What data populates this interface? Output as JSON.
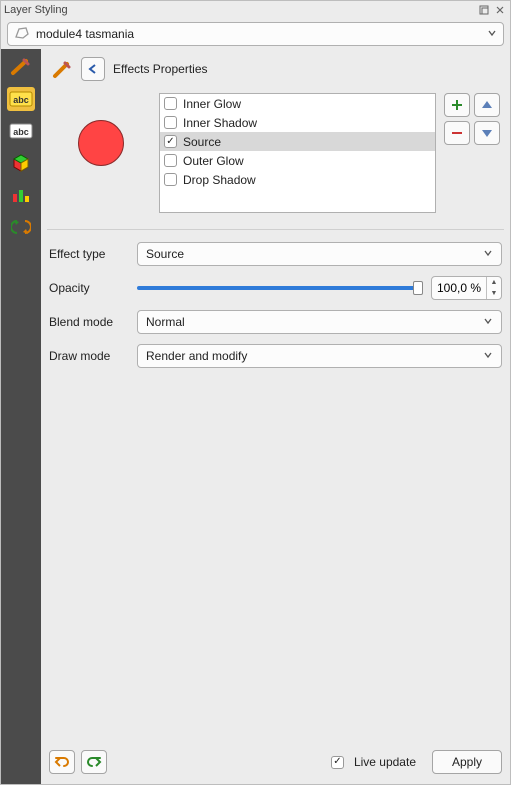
{
  "window": {
    "title": "Layer Styling"
  },
  "layer": {
    "name": "module4 tasmania"
  },
  "header": {
    "title": "Effects Properties"
  },
  "effects": {
    "items": [
      {
        "label": "Inner Glow",
        "checked": false,
        "selected": false
      },
      {
        "label": "Inner Shadow",
        "checked": false,
        "selected": false
      },
      {
        "label": "Source",
        "checked": true,
        "selected": true
      },
      {
        "label": "Outer Glow",
        "checked": false,
        "selected": false
      },
      {
        "label": "Drop Shadow",
        "checked": false,
        "selected": false
      }
    ]
  },
  "form": {
    "effect_type_label": "Effect type",
    "effect_type_value": "Source",
    "opacity_label": "Opacity",
    "opacity_value": "100,0 %",
    "opacity_fraction": 1.0,
    "blend_mode_label": "Blend mode",
    "blend_mode_value": "Normal",
    "draw_mode_label": "Draw mode",
    "draw_mode_value": "Render and modify"
  },
  "footer": {
    "live_update_label": "Live update",
    "live_update_checked": true,
    "apply_label": "Apply"
  },
  "colors": {
    "swatch": "#f44336"
  }
}
